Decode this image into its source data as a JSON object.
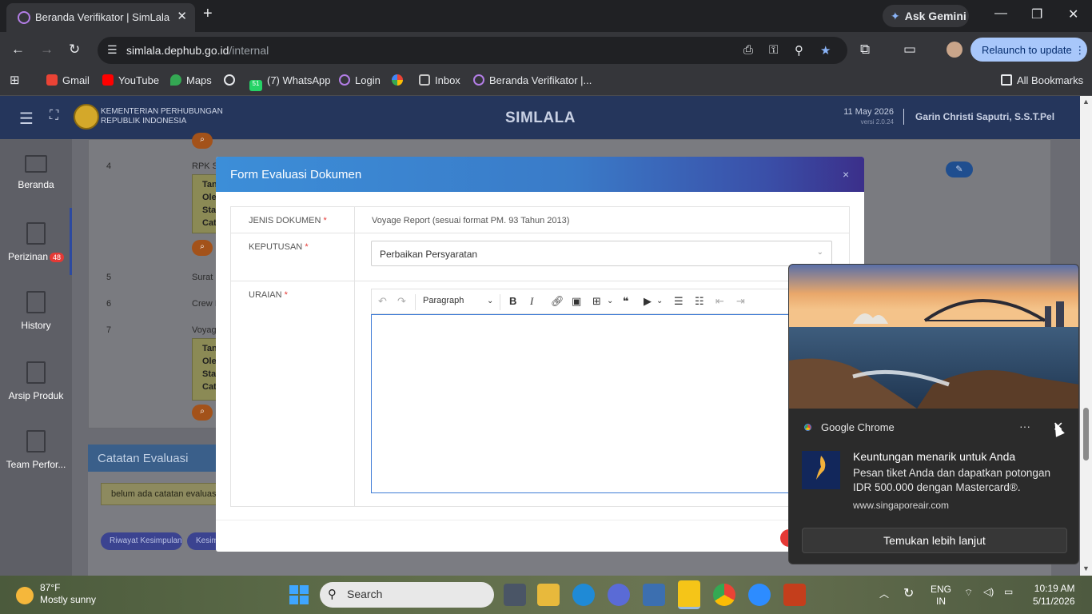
{
  "browser": {
    "tab_title": "Beranda Verifikator | SimLala",
    "gemini_label": "Ask Gemini",
    "url_host": "simlala.dephub.go.id",
    "url_path": "/internal",
    "relaunch_label": "Relaunch to update",
    "bookmarks": [
      "Gmail",
      "YouTube",
      "Maps",
      "(7) WhatsApp",
      "Login",
      "Inbox",
      "Beranda Verifikator |..."
    ],
    "whatsapp_count": "51",
    "all_bookmarks": "All Bookmarks"
  },
  "app": {
    "org_line1": "KEMENTERIAN PERHUBUNGAN",
    "org_line2": "REPUBLIK INDONESIA",
    "name": "SIMLALA",
    "date": "11 May 2026",
    "version": "versi 2.0.24",
    "user": "Garin Christi Saputri, S.S.T.Pel"
  },
  "sidebar": {
    "items": [
      {
        "label": "Beranda"
      },
      {
        "label": "Perizinan",
        "badge": "48"
      },
      {
        "label": "History"
      },
      {
        "label": "Arsip Produk"
      },
      {
        "label": "Team Perfor..."
      }
    ]
  },
  "table": {
    "rows": [
      {
        "num": "4",
        "text": "RPK Se"
      },
      {
        "num": "5",
        "text": "Surat D"
      },
      {
        "num": "6",
        "text": "Crew Il"
      },
      {
        "num": "7",
        "text": "Voyage"
      }
    ],
    "box_lines": [
      "Tan",
      "Ole",
      "Stat",
      "Cat"
    ]
  },
  "catatan": {
    "title": "Catatan Evaluasi",
    "note": "belum ada catatan evaluasi",
    "buttons": [
      "Riwayat Kesimpulan",
      "Kesim"
    ]
  },
  "modal": {
    "title": "Form Evaluasi Dokumen",
    "close": "×",
    "fields": {
      "jenis_label": "JENIS DOKUMEN",
      "jenis_value": "Voyage Report (sesuai format PM. 93 Tahun 2013)",
      "keputusan_label": "KEPUTUSAN",
      "keputusan_value": "Perbaikan Persyaratan",
      "uraian_label": "URAIAN",
      "required_mark": "*"
    },
    "editor": {
      "block_format": "Paragraph"
    }
  },
  "notification": {
    "app_name": "Google Chrome",
    "headline": "Keuntungan menarik untuk Anda",
    "body": "Pesan tiket Anda dan dapatkan potongan IDR 500.000 dengan Mastercard®.",
    "site": "www.singaporeair.com",
    "cta": "Temukan lebih lanjut",
    "logo_text": "SINGAPORE AIRLINES"
  },
  "taskbar": {
    "temp": "87°F",
    "weather": "Mostly sunny",
    "search_placeholder": "Search",
    "lang1": "ENG",
    "lang2": "IN",
    "time": "10:19 AM",
    "date": "5/11/2026"
  }
}
